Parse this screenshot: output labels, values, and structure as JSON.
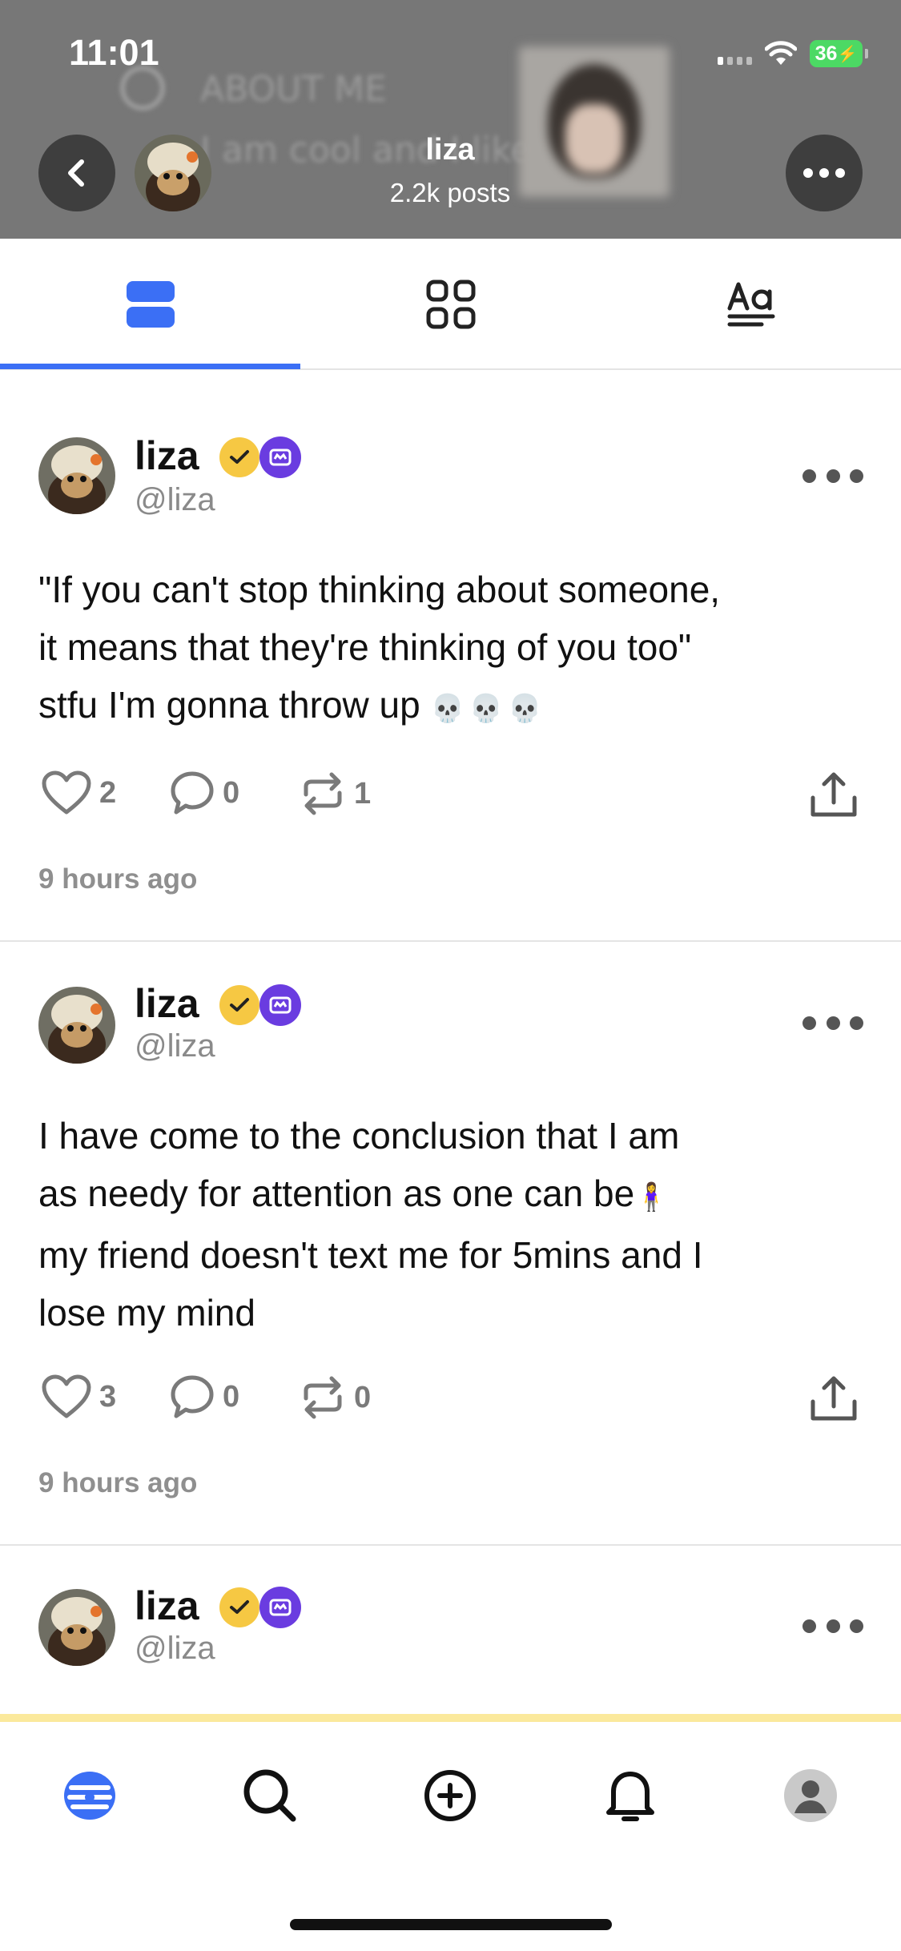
{
  "status_bar": {
    "time": "11:01",
    "battery": "36"
  },
  "header": {
    "background_title": "ABOUT ME",
    "background_bio": "I am cool and I like",
    "profile_name": "liza",
    "posts_count": "2.2k posts"
  },
  "tabs": [
    {
      "name": "posts",
      "icon": "list-icon",
      "active": true
    },
    {
      "name": "grid",
      "icon": "grid-icon",
      "active": false
    },
    {
      "name": "text",
      "icon": "text-format-icon",
      "active": false
    }
  ],
  "colors": {
    "accent": "#3b6ff5",
    "check_badge": "#f6c843",
    "crown_badge": "#6a3ce0",
    "battery": "#4cd964"
  },
  "posts": [
    {
      "name": "liza",
      "handle": "@liza",
      "lines": [
        "\"If you can't stop thinking about someone,",
        "it means that they're thinking of you too\"",
        "stfu I'm gonna throw up"
      ],
      "skulls": "💀💀💀",
      "likes": "2",
      "comments": "0",
      "reposts": "1",
      "time": "9 hours ago"
    },
    {
      "name": "liza",
      "handle": "@liza",
      "lines": [
        "I have come to the conclusion that I am",
        "as needy for attention as one can be",
        "my friend doesn't text me for 5mins and I",
        "lose my mind"
      ],
      "emoji": "🧍‍♀️",
      "likes": "3",
      "comments": "0",
      "reposts": "0",
      "time": "9 hours ago"
    },
    {
      "name": "liza",
      "handle": "@liza"
    }
  ],
  "bottom_nav": [
    "home-icon",
    "search-icon",
    "create-icon",
    "notifications-icon",
    "profile-icon"
  ]
}
